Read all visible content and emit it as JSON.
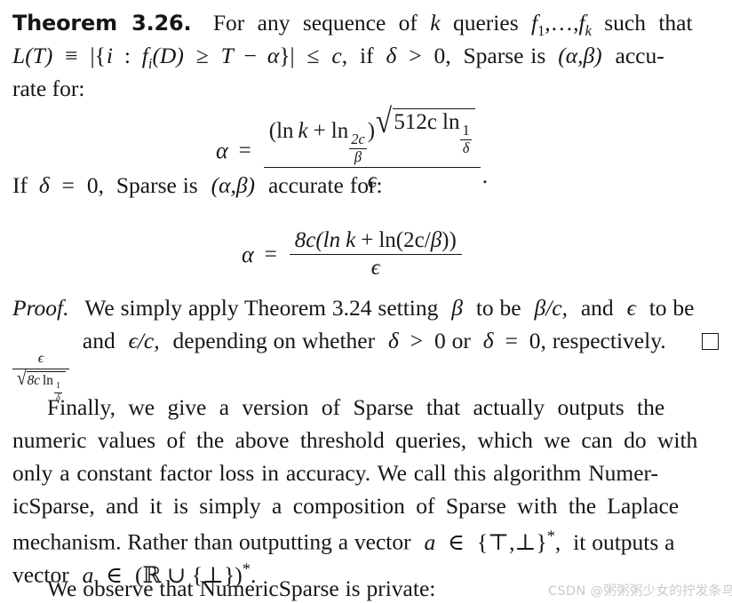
{
  "document": {
    "theorem": {
      "label": "Theorem 3.26.",
      "line1_rest": "For any sequence of k queries f₁,…,fₖ such that",
      "line1_parts": {
        "a": "For",
        "b": "any",
        "c": "sequence",
        "d": "of",
        "k": "k",
        "queries": "queries",
        "f1": "f",
        "sub1": "1",
        "dots": ",…,",
        "f2": "f",
        "subk": "k",
        "such": "such",
        "that": "that"
      },
      "line2": "L(T) ≡ |{i : fᵢ(D) ≥ T − α}| ≤ c, if δ > 0, Sparse is (α,β) accu-",
      "line2_parts": {
        "L": "L",
        "paren_T": "(T)",
        "equiv": "≡",
        "bar_open": "|{",
        "i": "i",
        "colon": ":",
        "f": "f",
        "isub": "i",
        "paren_D": "(D)",
        "geq": "≥",
        "T": "T",
        "minus": "−",
        "alpha": "α",
        "bar_close": "}|",
        "leq": "≤",
        "c": "c",
        "comma": ",",
        "if": "if",
        "delta": "δ",
        "gt": ">",
        "zero": "0,",
        "sparse_is": "Sparse is",
        "ab": "(α,β)",
        "accu": "accu-"
      },
      "line3": "rate for:",
      "line4": "If δ = 0, Sparse is (α,β) accurate for:",
      "line4_parts": {
        "If": "If",
        "delta": "δ",
        "eq": "=",
        "zero": "0,",
        "sparse_is": "Sparse is",
        "ab": "(α,β)",
        "accurate_for": "accurate for:"
      }
    },
    "equation1": {
      "lhs": "α",
      "op": "=",
      "numerator_open": "(ln",
      "numerator_k": "k",
      "numerator_plus": "+",
      "numerator_ln2": "ln",
      "numerator_frac_num": "2c",
      "numerator_frac_den": "β",
      "numerator_close": ")",
      "radicand_512c": "512c",
      "radicand_ln": "ln",
      "radicand_frac_num": "1",
      "radicand_frac_den": "δ",
      "denominator": "ϵ",
      "period": "."
    },
    "equation2": {
      "lhs": "α",
      "op": "=",
      "numerator": "8c(ln k + ln(2c/β))",
      "numerator_parts": {
        "coef": "8c(ln",
        "k": "k",
        "plus": "+",
        "ln2": "ln(2c/",
        "beta": "β",
        "close": "))"
      },
      "denominator": "ϵ"
    },
    "proof": {
      "label": "Proof.",
      "line1": "We simply apply Theorem 3.24 setting β to be β/c, and ϵ to be",
      "line1_parts": {
        "we_simply": "We simply apply Theorem 3.24 setting",
        "beta1": "β",
        "to_be": "to be",
        "beta_over_c": "β/c,",
        "and": "and",
        "eps": "ϵ",
        "to_be2": "to be"
      },
      "line2_frac_num": "ϵ",
      "line2_frac_den_coef": "8c",
      "line2_frac_den_ln": "ln",
      "line2_frac_den_num": "1",
      "line2_frac_den_den": "δ",
      "line2_rest": "and ϵ/c, depending on whether δ > 0 or δ = 0, respectively.",
      "line2_parts": {
        "and": "and",
        "eps_c": "ϵ/c,",
        "depending": "depending on whether",
        "delta1": "δ",
        "gt": ">",
        "zero_or": "0 or",
        "delta2": "δ",
        "eq": "=",
        "zero_resp": "0, respectively."
      },
      "qed_symbol": "□"
    },
    "paragraph": {
      "line1": "Finally, we give a version of Sparse that actually outputs the",
      "line2": "numeric values of the above threshold queries, which we can do with",
      "line3": "only a constant factor loss in accuracy. We call this algorithm Numer-",
      "line4": "icSparse, and it is simply a composition of Sparse with the Laplace",
      "line5_parts": {
        "a": "mechanism. Rather than outputting a vector",
        "var_a": "a",
        "in": "∈",
        "set": "{⊤,⊥}",
        "star": "*",
        "comma": ",",
        "b": "it outputs a"
      },
      "line6_parts": {
        "vector": "vector",
        "var_a": "a",
        "in": "∈",
        "set": "(ℝ ∪ {⊥})",
        "star": "*",
        "period": "."
      },
      "line7": "We observe that NumericSparse is private:"
    }
  },
  "watermark": {
    "text": "CSDN @粥粥粥少女的拧发条鸟",
    "color": "#c9c9cf"
  }
}
